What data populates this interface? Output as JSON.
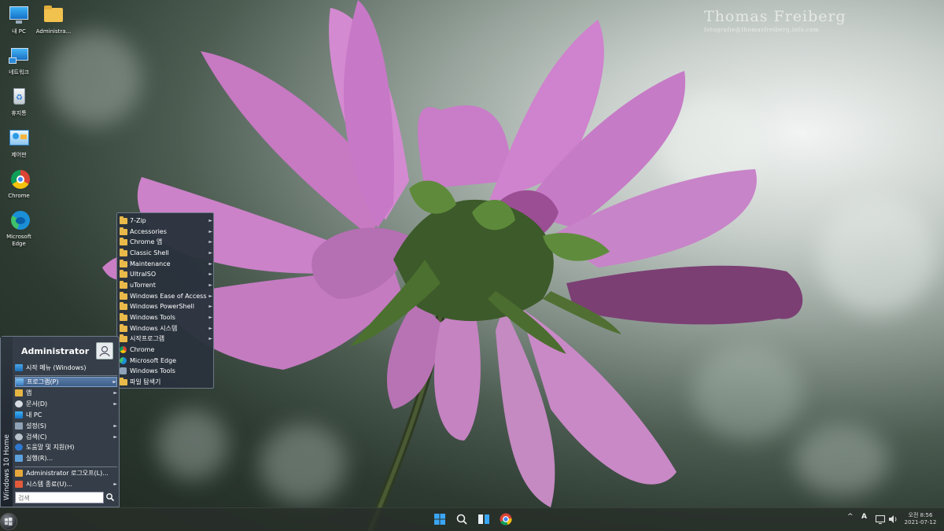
{
  "watermark": {
    "name": "Thomas Freiberg",
    "site": "fotografie@thomasfreiberg.info.com"
  },
  "desktop": {
    "icons": [
      {
        "label": "내 PC"
      },
      {
        "label": "Administra..."
      },
      {
        "label": "네트워크"
      },
      {
        "label": "휴지통"
      },
      {
        "label": "제어판"
      },
      {
        "label": "Chrome"
      },
      {
        "label": "Microsoft Edge"
      }
    ]
  },
  "start_menu": {
    "edition": "Windows 10 Home",
    "user": "Administrator",
    "items": [
      {
        "label": "시작 메뉴 (Windows)",
        "arrow": ""
      },
      {
        "label": "프로그램(P)",
        "arrow": "►"
      },
      {
        "label": "앱",
        "arrow": "►"
      },
      {
        "label": "문서(D)",
        "arrow": "►"
      },
      {
        "label": "내 PC",
        "arrow": ""
      },
      {
        "label": "설정(S)",
        "arrow": "►"
      },
      {
        "label": "검색(C)",
        "arrow": "►"
      },
      {
        "label": "도움말 및 지원(H)",
        "arrow": ""
      },
      {
        "label": "실행(R)...",
        "arrow": ""
      },
      {
        "label": "Administrator 로그오프(L)...",
        "arrow": ""
      },
      {
        "label": "시스템 종료(U)...",
        "arrow": "►"
      }
    ],
    "search_placeholder": "검색"
  },
  "programs_menu": {
    "folders": [
      "7-Zip",
      "Accessories",
      "Chrome 앱",
      "Classic Shell",
      "Maintenance",
      "UltraISO",
      "uTorrent",
      "Windows Ease of Access",
      "Windows PowerShell",
      "Windows Tools",
      "Windows 시스템",
      "시작프로그램"
    ],
    "apps": [
      "Chrome",
      "Microsoft Edge",
      "Windows Tools",
      "파일 탐색기"
    ],
    "arrow": "►"
  },
  "taskbar": {
    "tray": {
      "chevron": "^",
      "ime": "A"
    },
    "clock_time": "오전 8:56",
    "clock_date": "2021-07-12"
  },
  "colors": {
    "accent": "#3f5f8a",
    "folder": "#e9b949"
  }
}
